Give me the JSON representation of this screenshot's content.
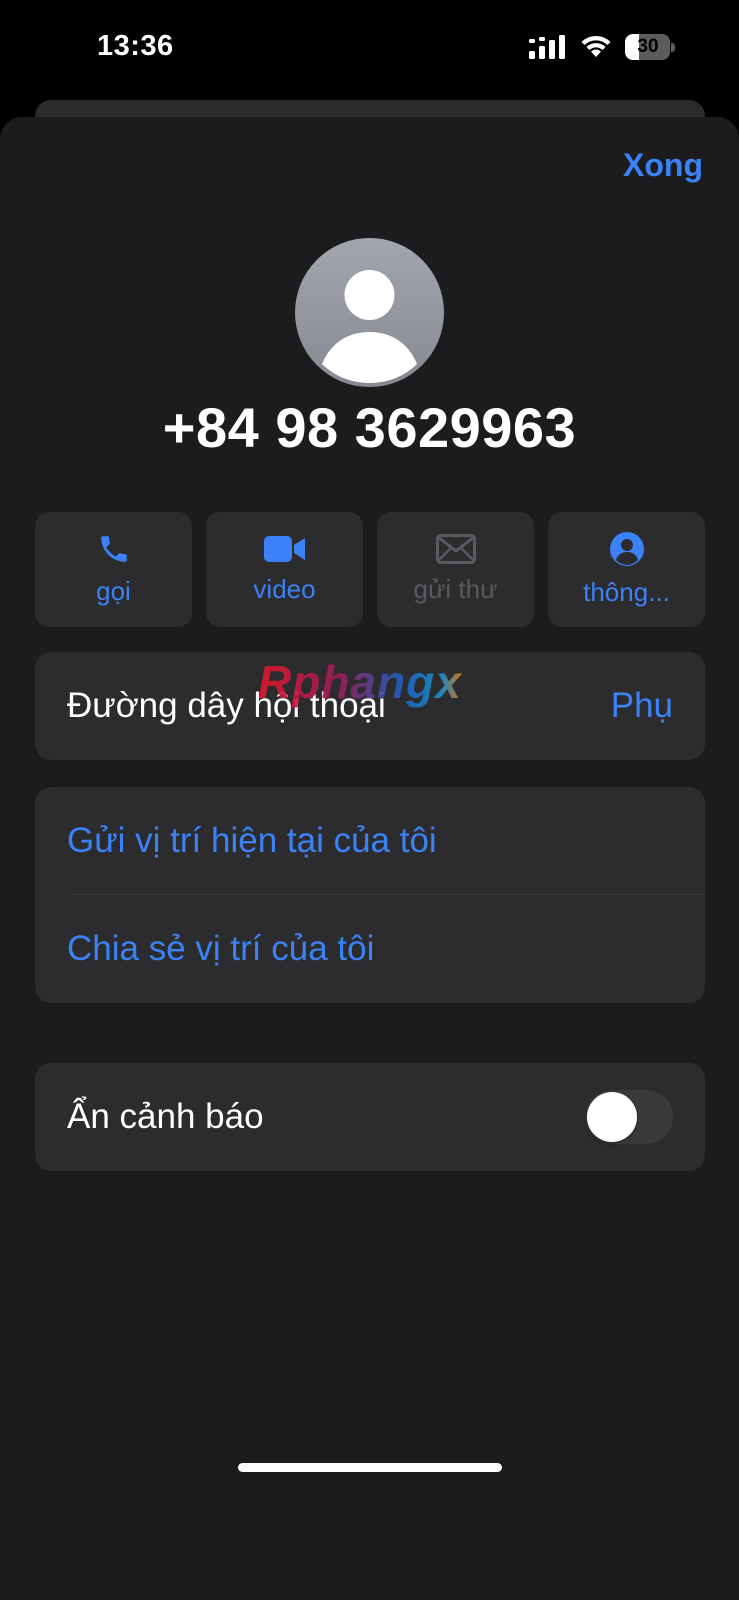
{
  "status_bar": {
    "time": "13:36",
    "battery_level": "30",
    "battery_fraction": 0.3,
    "icons": [
      "cellular-signal-icon",
      "wifi-icon",
      "battery-icon"
    ]
  },
  "header": {
    "done_label": "Xong"
  },
  "contact": {
    "avatar_icon": "person-silhouette-icon",
    "phone_number": "+84 98 3629963"
  },
  "actions": [
    {
      "label": "gọi",
      "icon": "phone-icon",
      "enabled": true
    },
    {
      "label": "video",
      "icon": "video-camera-icon",
      "enabled": true
    },
    {
      "label": "gửi thư",
      "icon": "envelope-icon",
      "enabled": false
    },
    {
      "label": "thông...",
      "icon": "person-circle-icon",
      "enabled": true
    }
  ],
  "conversation_line": {
    "label": "Đường dây hội thoại",
    "value": "Phụ"
  },
  "location": {
    "send_current": "Gửi vị trí hiện tại của tôi",
    "share": "Chia sẻ vị trí của tôi"
  },
  "alerts": {
    "label": "Ẩn cảnh báo",
    "toggle_on": false
  },
  "watermark": {
    "text": "Rphangx"
  },
  "colors": {
    "accent": "#3b82f6",
    "sheet_bg": "#1c1c1e",
    "cell_bg": "#2c2c2e",
    "disabled": "#5a5a5e"
  }
}
